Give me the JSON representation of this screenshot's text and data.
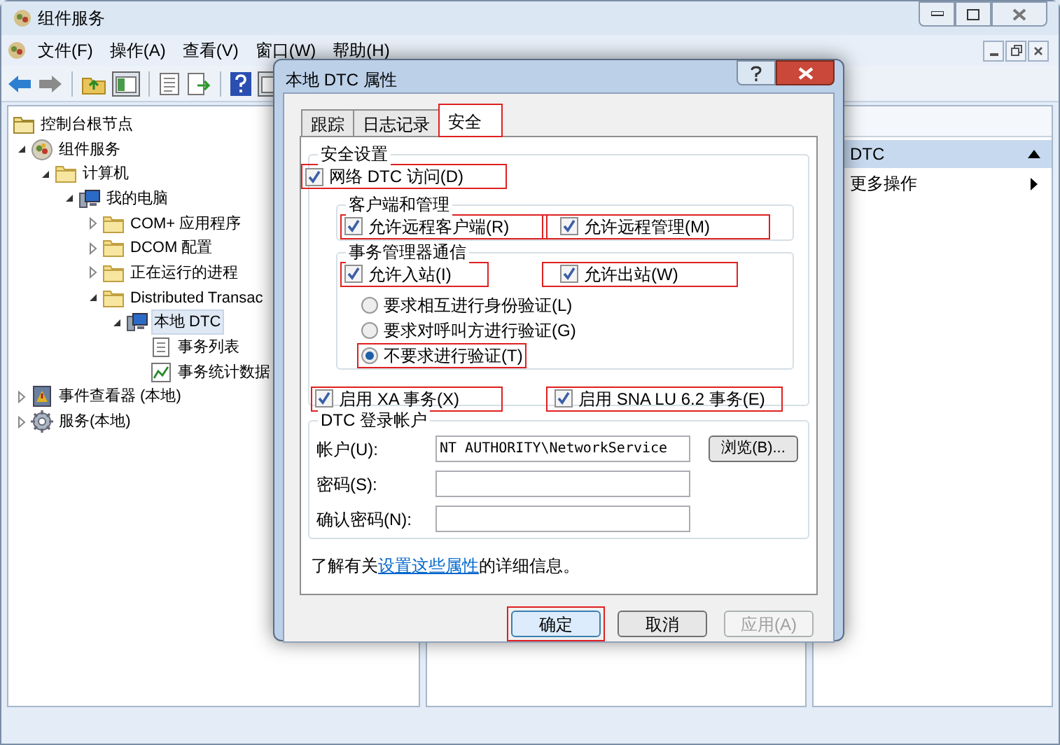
{
  "window": {
    "title": "组件服务"
  },
  "menu": [
    "文件(F)",
    "操作(A)",
    "查看(V)",
    "窗口(W)",
    "帮助(H)"
  ],
  "tree": [
    {
      "label": "控制台根节点",
      "kind": "console",
      "selected": false,
      "children": [
        {
          "label": "组件服务",
          "kind": "components",
          "expanded": true,
          "selected": false,
          "children": [
            {
              "label": "计算机",
              "kind": "folder",
              "expanded": true,
              "selected": false,
              "children": [
                {
                  "label": "我的电脑",
                  "kind": "computer",
                  "expanded": true,
                  "selected": false,
                  "children": [
                    {
                      "label": "COM+ 应用程序",
                      "kind": "folder",
                      "expanded": false,
                      "selected": false
                    },
                    {
                      "label": "DCOM 配置",
                      "kind": "folder",
                      "expanded": false,
                      "selected": false
                    },
                    {
                      "label": "正在运行的进程",
                      "kind": "folder",
                      "expanded": false,
                      "selected": false
                    },
                    {
                      "label": "Distributed Transac",
                      "kind": "folder",
                      "expanded": true,
                      "selected": false,
                      "children": [
                        {
                          "label": "本地 DTC",
                          "kind": "computer",
                          "expanded": true,
                          "selected": true,
                          "children": [
                            {
                              "label": "事务列表",
                              "kind": "list",
                              "selected": false
                            },
                            {
                              "label": "事务统计数据",
                              "kind": "chart",
                              "selected": false
                            }
                          ]
                        }
                      ]
                    }
                  ]
                }
              ]
            }
          ]
        },
        {
          "label": "事件查看器 (本地)",
          "kind": "events",
          "expanded": false,
          "selected": false
        },
        {
          "label": "服务(本地)",
          "kind": "services",
          "expanded": false,
          "selected": false
        }
      ]
    }
  ],
  "actions": {
    "header": "DTC",
    "items": [
      "更多操作"
    ]
  },
  "dialog": {
    "title": "本地 DTC 属性",
    "tabs": [
      {
        "label": "跟踪",
        "selected": false,
        "highlighted": false
      },
      {
        "label": "日志记录",
        "selected": false,
        "highlighted": false
      },
      {
        "label": "安全",
        "selected": true,
        "highlighted": true
      }
    ],
    "security": {
      "legend": "安全设置",
      "network_access": {
        "label": "网络 DTC 访问(D)",
        "checked": true,
        "highlighted": true
      },
      "client_admin": {
        "legend": "客户端和管理",
        "options": [
          {
            "label": "允许远程客户端(R)",
            "checked": true,
            "highlighted": true
          },
          {
            "label": "允许远程管理(M)",
            "checked": true,
            "highlighted": true
          }
        ]
      },
      "tm_comm": {
        "legend": "事务管理器通信",
        "options": [
          {
            "label": "允许入站(I)",
            "checked": true,
            "highlighted": true
          },
          {
            "label": "允许出站(W)",
            "checked": true,
            "highlighted": true
          }
        ],
        "auth": [
          {
            "label": "要求相互进行身份验证(L)",
            "selected": false,
            "highlighted": false
          },
          {
            "label": "要求对呼叫方进行验证(G)",
            "selected": false,
            "highlighted": false
          },
          {
            "label": "不要求进行验证(T)",
            "selected": true,
            "highlighted": true
          }
        ]
      },
      "transactions": [
        {
          "label": "启用 XA 事务(X)",
          "checked": true,
          "highlighted": true
        },
        {
          "label": "启用 SNA LU 6.2 事务(E)",
          "checked": true,
          "highlighted": true
        }
      ]
    },
    "logon": {
      "legend": "DTC 登录帐户",
      "fields": [
        {
          "label": "帐户(U):",
          "value": "NT AUTHORITY\\NetworkService"
        },
        {
          "label": "密码(S):"
        },
        {
          "label": "确认密码(N):"
        }
      ],
      "browse": "浏览(B)..."
    },
    "footer": {
      "before": "了解有关",
      "link": "设置这些属性",
      "after": "的详细信息。"
    },
    "buttons": [
      {
        "label": "确定",
        "highlighted": true,
        "disabled": false
      },
      {
        "label": "取消",
        "highlighted": false,
        "disabled": false
      },
      {
        "label": "应用(A)",
        "highlighted": false,
        "disabled": true
      }
    ]
  }
}
